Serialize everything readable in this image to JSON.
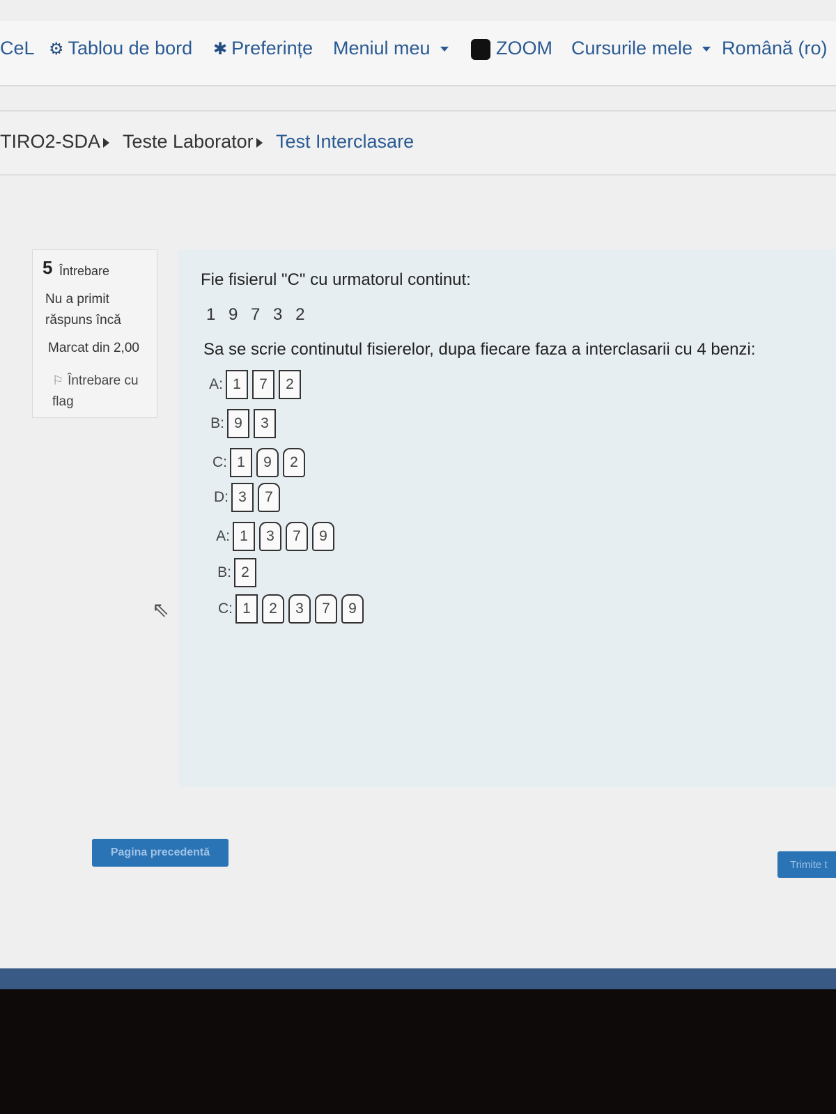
{
  "nav": {
    "items": [
      {
        "label": "CeL",
        "icon": ""
      },
      {
        "label": "Tablou de bord",
        "icon": "dashboard-icon"
      },
      {
        "label": "Preferințe",
        "icon": "gear-icon"
      },
      {
        "label": "Meniul meu",
        "icon": "chevron-down-icon"
      },
      {
        "label": "ZOOM",
        "icon": "zoom-icon"
      },
      {
        "label": "Cursurile mele",
        "icon": "chevron-down-icon"
      },
      {
        "label": "Română (ro)",
        "icon": ""
      }
    ]
  },
  "breadcrumb": {
    "items": [
      "TIRO2-SDA",
      "Teste Laborator",
      "Test Interclasare"
    ]
  },
  "question_info": {
    "number": "5",
    "word": "Întrebare",
    "state": "Nu a primit răspuns încă",
    "mark": "Marcat din 2,00",
    "flag": "Întrebare cu flag"
  },
  "question": {
    "text": "Fie fisierul \"C\" cu urmatorul continut:",
    "sequence": "1 9 7 3 2",
    "task": "Sa se scrie continutul fisierelor, dupa fiecare faza a interclasarii cu 4 benzi:",
    "rows": [
      {
        "label": "A:",
        "values": [
          "1",
          "7",
          "2"
        ]
      },
      {
        "label": "B:",
        "values": [
          "9",
          "3"
        ]
      },
      {
        "label": "C:",
        "values": [
          "1",
          "9",
          "2"
        ]
      },
      {
        "label": "D:",
        "values": [
          "3",
          "7"
        ]
      },
      {
        "label": "A:",
        "values": [
          "1",
          "3",
          "7",
          "9"
        ]
      },
      {
        "label": "B:",
        "values": [
          "2"
        ]
      },
      {
        "label": "C:",
        "values": [
          "1",
          "2",
          "3",
          "7",
          "9"
        ]
      }
    ]
  },
  "buttons": {
    "prev": "Pagina precedentă",
    "next": "Trimite t"
  }
}
